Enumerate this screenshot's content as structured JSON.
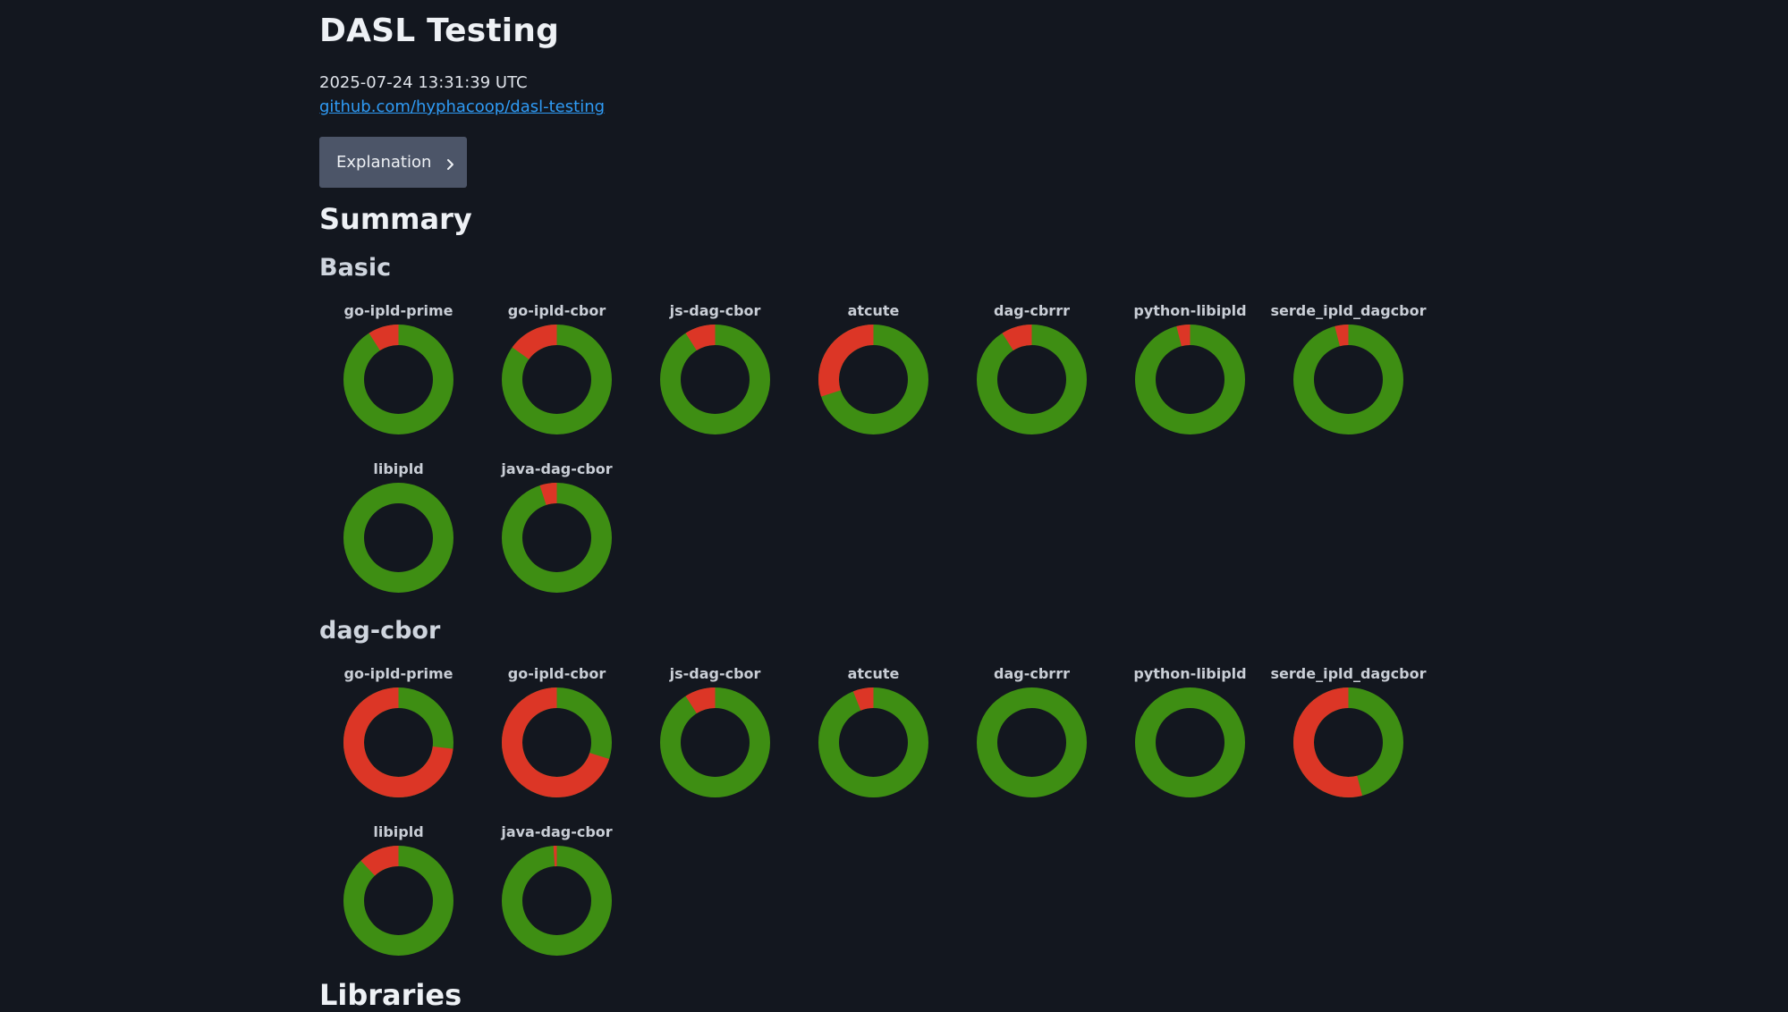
{
  "header": {
    "title": "DASL Testing",
    "timestamp": "2025-07-24 13:31:39 UTC",
    "repo_link": "github.com/hyphacoop/dasl-testing",
    "explanation_button": "Explanation",
    "explanation_icon": "chevron-right-icon"
  },
  "summary": {
    "heading": "Summary",
    "colors": {
      "pass": "#3e8e13",
      "fail": "#dc3626"
    },
    "groups": [
      {
        "heading": "Basic",
        "libraries": [
          {
            "name": "go-ipld-prime",
            "fail_fraction": 0.09
          },
          {
            "name": "go-ipld-cbor",
            "fail_fraction": 0.15
          },
          {
            "name": "js-dag-cbor",
            "fail_fraction": 0.09
          },
          {
            "name": "atcute",
            "fail_fraction": 0.3
          },
          {
            "name": "dag-cbrrr",
            "fail_fraction": 0.09
          },
          {
            "name": "python-libipld",
            "fail_fraction": 0.04
          },
          {
            "name": "serde_ipld_dagcbor",
            "fail_fraction": 0.04
          },
          {
            "name": "libipld",
            "fail_fraction": 0.0
          },
          {
            "name": "java-dag-cbor",
            "fail_fraction": 0.05
          }
        ]
      },
      {
        "heading": "dag-cbor",
        "libraries": [
          {
            "name": "go-ipld-prime",
            "fail_fraction": 0.73
          },
          {
            "name": "go-ipld-cbor",
            "fail_fraction": 0.7
          },
          {
            "name": "js-dag-cbor",
            "fail_fraction": 0.09
          },
          {
            "name": "atcute",
            "fail_fraction": 0.06
          },
          {
            "name": "dag-cbrrr",
            "fail_fraction": 0.0
          },
          {
            "name": "python-libipld",
            "fail_fraction": 0.0
          },
          {
            "name": "serde_ipld_dagcbor",
            "fail_fraction": 0.54
          },
          {
            "name": "libipld",
            "fail_fraction": 0.12
          },
          {
            "name": "java-dag-cbor",
            "fail_fraction": 0.01
          }
        ]
      }
    ]
  },
  "libraries": {
    "heading": "Libraries"
  }
}
